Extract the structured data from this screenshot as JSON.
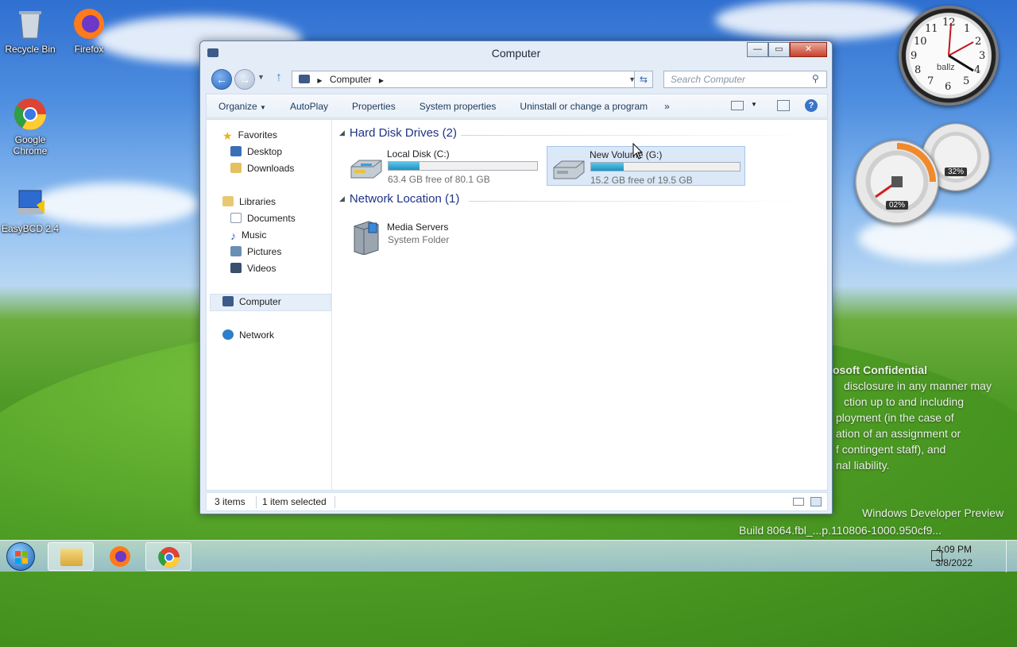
{
  "desktop": {
    "icons": [
      {
        "label": "Recycle Bin",
        "icon": "recycle-bin-icon"
      },
      {
        "label": "Firefox",
        "icon": "firefox-icon"
      },
      {
        "label": "Google Chrome",
        "icon": "chrome-icon"
      },
      {
        "label": "EasyBCD 2.4",
        "icon": "easybcd-icon"
      }
    ]
  },
  "gadgets": {
    "clock": {
      "label": "ballz",
      "numbers": [
        "12",
        "1",
        "2",
        "3",
        "4",
        "5",
        "6",
        "7",
        "8",
        "9",
        "10",
        "11"
      ]
    },
    "cpu_percent": "02%",
    "memory_percent": "32%"
  },
  "watermark": {
    "lines": [
      "osoft Confidential",
      "disclosure in any manner may",
      "ction up to and including",
      "ployment (in the case of",
      "ation of an assignment or",
      "f contingent staff), and",
      "nal liability.",
      "Windows Developer Preview",
      "Build 8064.fbl_...p.110806-1000.950cf9..."
    ]
  },
  "window": {
    "title": "Computer",
    "controls": {
      "minimize": "—",
      "maximize": "▭",
      "close": "✕"
    },
    "address": "Computer",
    "search_placeholder": "Search Computer",
    "toolbar": {
      "organize": "Organize",
      "autoplay": "AutoPlay",
      "properties": "Properties",
      "system_properties": "System properties",
      "uninstall": "Uninstall or change a program",
      "more": "»"
    },
    "nav": {
      "favorites": "Favorites",
      "desktop": "Desktop",
      "downloads": "Downloads",
      "libraries": "Libraries",
      "documents": "Documents",
      "music": "Music",
      "pictures": "Pictures",
      "videos": "Videos",
      "computer": "Computer",
      "network": "Network"
    },
    "groups": {
      "hard_disk_drives": "Hard Disk Drives (2)",
      "network_location": "Network Location (1)"
    },
    "drives": [
      {
        "name": "Local Disk (C:)",
        "free": "63.4 GB free of 80.1 GB",
        "used_fraction": 0.21,
        "selected": false
      },
      {
        "name": "New Volume (G:)",
        "free": "15.2 GB free of 19.5 GB",
        "used_fraction": 0.22,
        "selected": true
      }
    ],
    "network_items": [
      {
        "name": "Media Servers",
        "type": "System Folder"
      }
    ],
    "status": {
      "items": "3 items",
      "selected": "1 item selected"
    }
  },
  "taskbar": {
    "time": "4:09 PM",
    "date": "3/8/2022"
  }
}
